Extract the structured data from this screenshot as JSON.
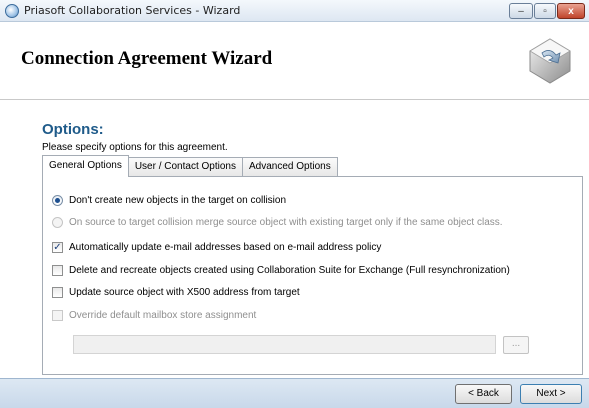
{
  "window": {
    "title": "Priasoft Collaboration Services - Wizard",
    "controls": {
      "minimize": "–",
      "maximize": "▫",
      "close": "x"
    }
  },
  "header": {
    "title": "Connection Agreement Wizard",
    "icon": "wizard-gear-icon"
  },
  "options": {
    "title": "Options:",
    "description": "Please specify options for this agreement."
  },
  "tabs": [
    {
      "label": "General Options",
      "active": true
    },
    {
      "label": "User / Contact Options",
      "active": false
    },
    {
      "label": "Advanced Options",
      "active": false
    }
  ],
  "general": {
    "radio_no_create": {
      "label": "Don't create new objects in the target on collision",
      "checked": true,
      "enabled": true
    },
    "radio_merge": {
      "label": "On source to target collision merge source object with existing target only if the same object class.",
      "checked": false,
      "enabled": false
    },
    "check_update_email": {
      "label": "Automatically update e-mail addresses based on e-mail address policy",
      "checked": true,
      "enabled": true
    },
    "check_delete_recreate": {
      "label": "Delete and recreate objects created using Collaboration Suite for Exchange (Full resynchronization)",
      "checked": false,
      "enabled": true
    },
    "check_update_x500": {
      "label": "Update source object with X500 address from target",
      "checked": false,
      "enabled": true
    },
    "check_override_mailbox": {
      "label": "Override default mailbox store assignment",
      "checked": false,
      "enabled": false
    },
    "mailbox_path": {
      "value": ""
    },
    "browse_label": "..."
  },
  "footer": {
    "back_label": "< Back",
    "next_label": "Next >"
  },
  "colors": {
    "section_title": "#1f5b8a",
    "footer_bg": "#c8d8ea",
    "disabled_text": "#8f8f8f"
  }
}
